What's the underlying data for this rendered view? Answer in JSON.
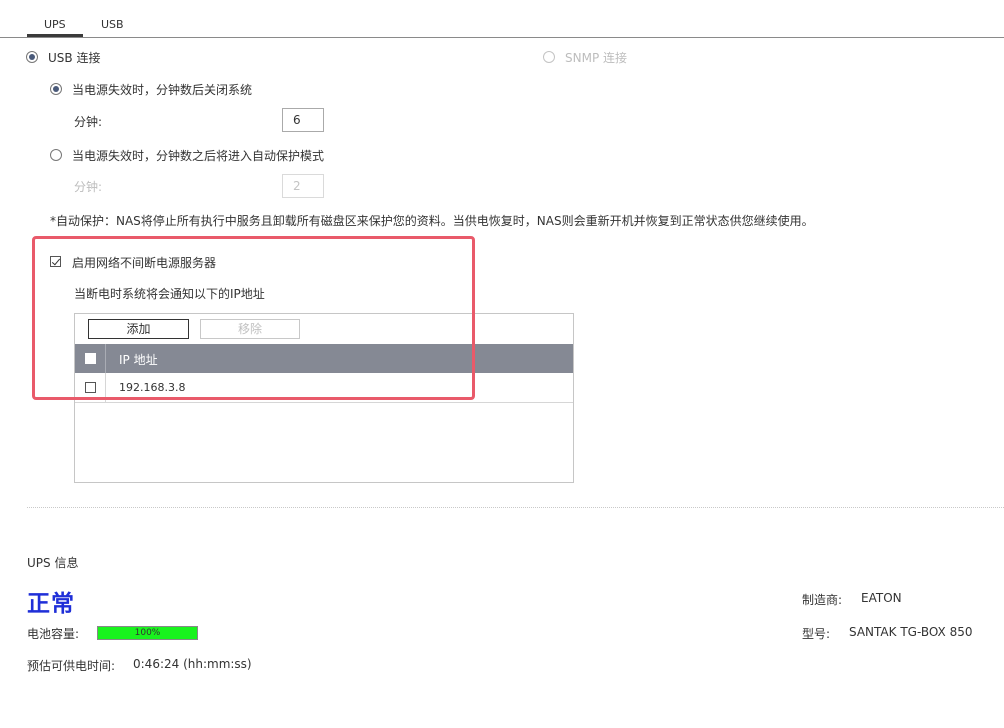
{
  "tabs": [
    {
      "label": "UPS",
      "active": true
    },
    {
      "label": "USB",
      "active": false
    }
  ],
  "connection": {
    "usb_label": "USB 连接",
    "usb_selected": true,
    "snmp_label": "SNMP 连接",
    "snmp_enabled": false
  },
  "power_fail": {
    "option1_label": "当电源失效时，分钟数后关闭系统",
    "option1_minutes_label": "分钟:",
    "option1_minutes_value": "6",
    "option2_label": "当电源失效时，分钟数之后将进入自动保护模式",
    "option2_minutes_label": "分钟:",
    "option2_minutes_value": "2",
    "note": "*自动保护：NAS将停止所有执行中服务且卸载所有磁盘区来保护您的资料。当供电恢复时，NAS则会重新开机并恢复到正常状态供您继续使用。"
  },
  "network_server": {
    "enable_label": "启用网络不间断电源服务器",
    "enabled": true,
    "notify_label": "当断电时系统将会通知以下的IP地址",
    "add_button": "添加",
    "remove_button": "移除",
    "column_header": "IP 地址",
    "ip_list": [
      "192.168.3.8"
    ]
  },
  "ups_info": {
    "section_title": "UPS 信息",
    "status": "正常",
    "battery_label": "电池容量:",
    "battery_percent": 100,
    "battery_text": "100%",
    "runtime_label": "预估可供电时间:",
    "runtime_value": "0:46:24 (hh:mm:ss)",
    "manufacturer_label": "制造商:",
    "manufacturer_value": "EATON",
    "model_label": "型号:",
    "model_value": "SANTAK TG-BOX 850"
  },
  "colors": {
    "highlight_border": "#e95a6a",
    "status_text": "#1f2fd8",
    "battery_fill": "#19f31d",
    "table_header": "#858994"
  }
}
